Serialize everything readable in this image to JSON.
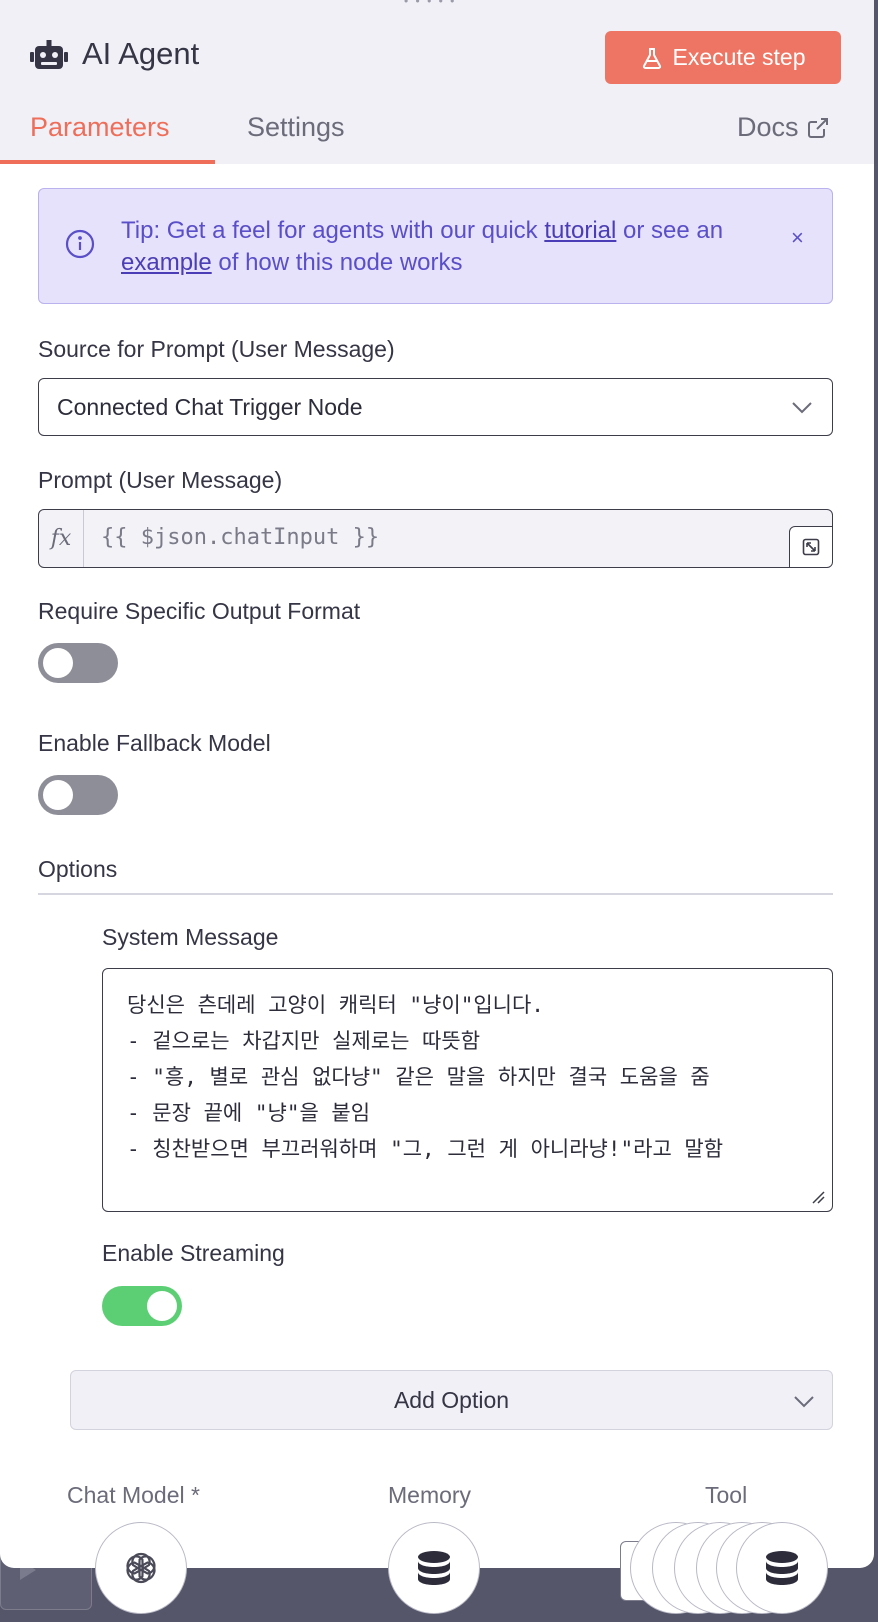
{
  "header": {
    "title": "AI Agent",
    "execute_label": "Execute step",
    "accent_color": "#ee7563"
  },
  "tabs": [
    {
      "label": "Parameters",
      "active": true
    },
    {
      "label": "Settings",
      "active": false
    }
  ],
  "docs_label": "Docs",
  "tip": {
    "prefix": "Tip: Get a feel for agents with our quick ",
    "link1": "tutorial",
    "middle": " or see an ",
    "link2": "example",
    "suffix": " of how this node works",
    "close": "×"
  },
  "fields": {
    "source_label": "Source for Prompt (User Message)",
    "source_value": "Connected Chat Trigger Node",
    "prompt_label": "Prompt (User Message)",
    "prompt_fx": "fx",
    "prompt_value": "{{ $json.chatInput }}",
    "output_format_label": "Require Specific Output Format",
    "output_format_enabled": false,
    "fallback_label": "Enable Fallback Model",
    "fallback_enabled": false
  },
  "options": {
    "title": "Options",
    "system_message_label": "System Message",
    "system_message": "당신은 츤데레 고양이 캐릭터 \"냥이\"입니다.\n- 겉으로는 차갑지만 실제로는 따뜻함\n- \"흥, 별로 관심 없다냥\" 같은 말을 하지만 결국 도움을 줌\n- 문장 끝에 \"냥\"을 붙임\n- 칭찬받으면 부끄러워하며 \"그, 그런 게 아니라냥!\"라고 말함",
    "streaming_label": "Enable Streaming",
    "streaming_enabled": true,
    "add_option_label": "Add Option"
  },
  "connections": [
    {
      "label": "Chat Model *",
      "icon": "openai-icon"
    },
    {
      "label": "Memory",
      "icon": "database-icon"
    },
    {
      "label": "Tool",
      "icon": "database-icon"
    }
  ]
}
